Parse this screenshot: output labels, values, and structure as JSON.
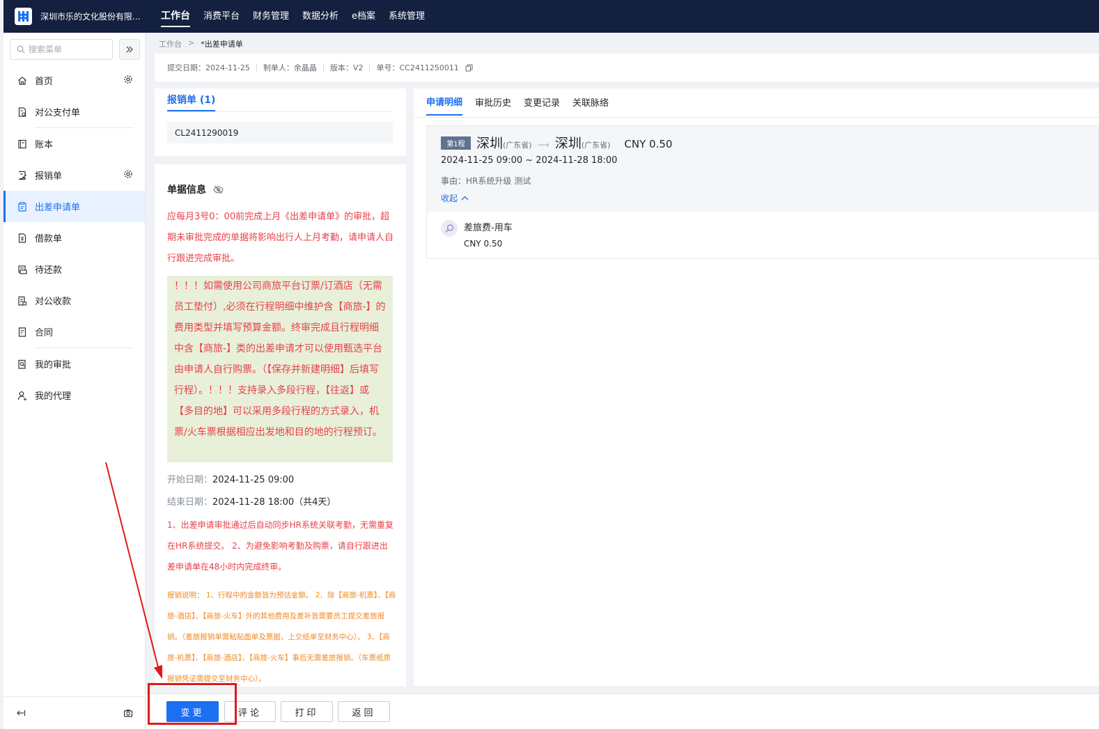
{
  "header": {
    "company": "深圳市乐的文化股份有限...",
    "nav": [
      "工作台",
      "消费平台",
      "财务管理",
      "数据分析",
      "e档案",
      "系统管理"
    ],
    "active_nav": 0
  },
  "sidebar": {
    "search_placeholder": "搜索菜单",
    "items": [
      {
        "label": "首页",
        "icon": "home-icon"
      },
      {
        "label": "对公支付单",
        "icon": "payment-doc-icon"
      },
      {
        "label": "账本",
        "icon": "ledger-icon"
      },
      {
        "label": "报销单",
        "icon": "reimburse-icon"
      },
      {
        "label": "出差申请单",
        "icon": "travel-request-icon"
      },
      {
        "label": "借款单",
        "icon": "loan-icon"
      },
      {
        "label": "待还款",
        "icon": "repayment-icon"
      },
      {
        "label": "对公收款",
        "icon": "receipt-icon"
      },
      {
        "label": "合同",
        "icon": "contract-icon"
      },
      {
        "label": "我的审批",
        "icon": "approval-icon"
      },
      {
        "label": "我的代理",
        "icon": "agent-icon"
      }
    ],
    "active_item": 4
  },
  "breadcrumb": {
    "root": "工作台",
    "current": "*出差申请单"
  },
  "docinfo": {
    "submit_date": "提交日期：2024-11-25",
    "maker": "制单人：余晶晶",
    "version": "版本：V2",
    "number": "单号：CC2411250011"
  },
  "linked": {
    "tab": "报销单 (1)",
    "code": "CL2411290019"
  },
  "detail": {
    "title": "单据信息",
    "notice1": "应每月3号0：00前完成上月《出差申请单》的审批，超期未审批完成的单据将影响出行人上月考勤，请申请人自行跟进完成审批。",
    "notice_box": "！！！如需使用公司商旅平台订票/订酒店（无需员工垫付）,必须在行程明细中维护含【商旅-】的费用类型并填写预算金额。终审完成且行程明细中含【商旅-】类的出差申请才可以使用甄选平台由申请人自行购票。（【保存并新建明细】后填写行程）。！！！支持录入多段行程，【往返】或【多目的地】可以采用多段行程的方式录入，机票/火车票根据相应出发地和目的地的行程预订。",
    "start_label": "开始日期：",
    "start_value": "2024-11-25 09:00",
    "end_label": "结束日期：",
    "end_value": "2024-11-28 18:00（共4天）",
    "notice2": "1、出差申请审批通过后自动同步HR系统关联考勤，无需重复在HR系统提交。 2、为避免影响考勤及购票，请自行跟进出差申请单在48小时内完成终审。",
    "notice3": "报销说明： 1、行程中的金额皆为预估金额。 2、除【商旅-机票】、【商旅-酒店】、【商旅-火车】外的其他费用及差补皆需要员工提交差旅报销。（差旅报销单需粘贴面单及票据，上交纸单至财务中心）。 3、【商旅-机票】、【商旅-酒店】、【商旅-火车】事后无需差旅报销。（车票纸质报销凭证需提交至财务中心）。"
  },
  "tabs": [
    "申请明细",
    "审批历史",
    "变更记录",
    "关联脉络"
  ],
  "active_tab": 0,
  "trip": {
    "badge": "第1程",
    "from_city": "深圳",
    "from_prov": "(广东省)",
    "to_city": "深圳",
    "to_prov": "(广东省)",
    "amount": "CNY 0.50",
    "time": "2024-11-25 09:00 ~ 2024-11-28 18:00",
    "reason_label": "事由：",
    "reason": "HR系统升级 测试",
    "collapse": "收起",
    "expense_name": "差旅费-用车",
    "expense_amount": "CNY 0.50"
  },
  "footer": {
    "change": "变更",
    "comment": "评论",
    "print": "打印",
    "back": "返回"
  },
  "colors": {
    "primary": "#1d6ff2",
    "header_bg": "#13203f",
    "warning_red": "#e8414b",
    "warning_orange": "#f08a24",
    "notice_green": "#e8f0d9",
    "annotation_red": "#e01818"
  }
}
